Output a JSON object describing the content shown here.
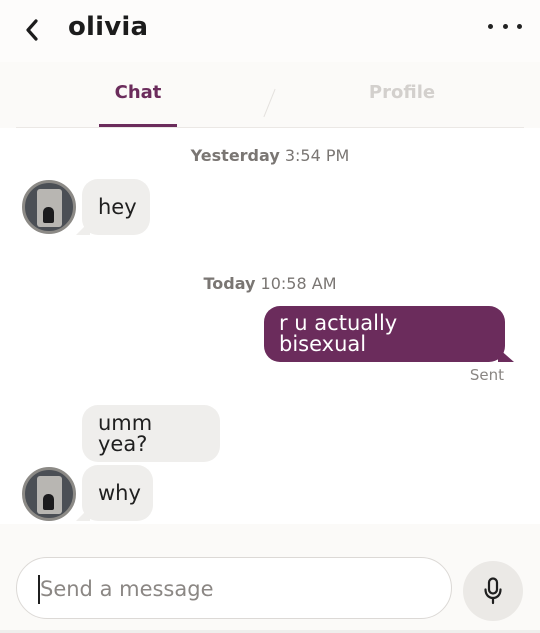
{
  "header": {
    "title": "olivia",
    "back_icon": "chevron-left-icon",
    "more_icon": "more-horizontal-icon"
  },
  "tabs": [
    {
      "label": "Chat",
      "active": true
    },
    {
      "label": "Profile",
      "active": false
    }
  ],
  "conversation": {
    "timestamps": [
      {
        "day": "Yesterday",
        "time": "3:54 PM"
      },
      {
        "day": "Today",
        "time": "10:58 AM"
      }
    ],
    "messages": [
      {
        "from": "them",
        "text": "hey"
      },
      {
        "from": "me",
        "text": "r u actually bisexual",
        "status": "Sent"
      },
      {
        "from": "them",
        "text": "umm yea?"
      },
      {
        "from": "them",
        "text": "why"
      }
    ]
  },
  "composer": {
    "placeholder": "Send a message",
    "value": "",
    "mic_icon": "microphone-icon"
  },
  "colors": {
    "accent": "#6b2c5c",
    "incoming_bubble": "#efeeec",
    "outgoing_bubble": "#6b2c5c"
  }
}
